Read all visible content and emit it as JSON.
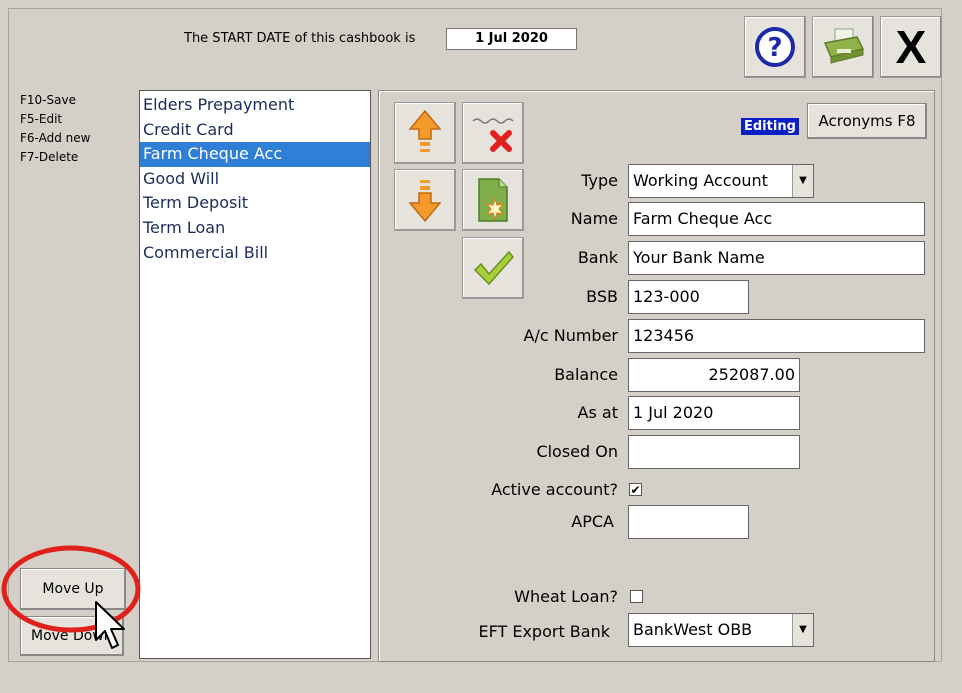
{
  "header": {
    "start_date_label": "The START DATE of this cashbook is",
    "start_date_value": "1 Jul 2020"
  },
  "toolbar": {
    "help_icon": "question-mark-icon",
    "print_icon": "printer-icon",
    "close_label": "X"
  },
  "shortcuts": [
    "F10-Save",
    "F5-Edit",
    "F6-Add new",
    "F7-Delete"
  ],
  "accounts": {
    "items": [
      "Elders Prepayment",
      "Credit Card",
      "Farm Cheque Acc",
      "Good Will",
      "Term Deposit",
      "Term Loan",
      "Commercial Bill"
    ],
    "selected_index": 2
  },
  "move_buttons": {
    "up_label": "Move Up",
    "down_label": "Move Down"
  },
  "status": {
    "editing_label": "Editing",
    "acronyms_label": "Acronyms F8"
  },
  "form": {
    "type_label": "Type",
    "type_value": "Working Account",
    "name_label": "Name",
    "name_value": "Farm Cheque Acc",
    "bank_label": "Bank",
    "bank_value": "Your Bank Name",
    "bsb_label": "BSB",
    "bsb_value": "123-000",
    "acnum_label": "A/c Number",
    "acnum_value": "123456",
    "balance_label": "Balance",
    "balance_value": "252087.00",
    "asat_label": "As at",
    "asat_value": "1 Jul 2020",
    "closed_label": "Closed On",
    "closed_value": "",
    "active_label": "Active account?",
    "active_checked": true,
    "apca_label": "APCA",
    "apca_value": "",
    "wheat_label": "Wheat Loan?",
    "wheat_checked": false,
    "eft_label": "EFT Export Bank",
    "eft_value": "BankWest OBB"
  },
  "colors": {
    "accent_selection": "#2f7fd6",
    "editing_badge": "#0a1fc4",
    "annotation_circle": "#e0201a"
  }
}
